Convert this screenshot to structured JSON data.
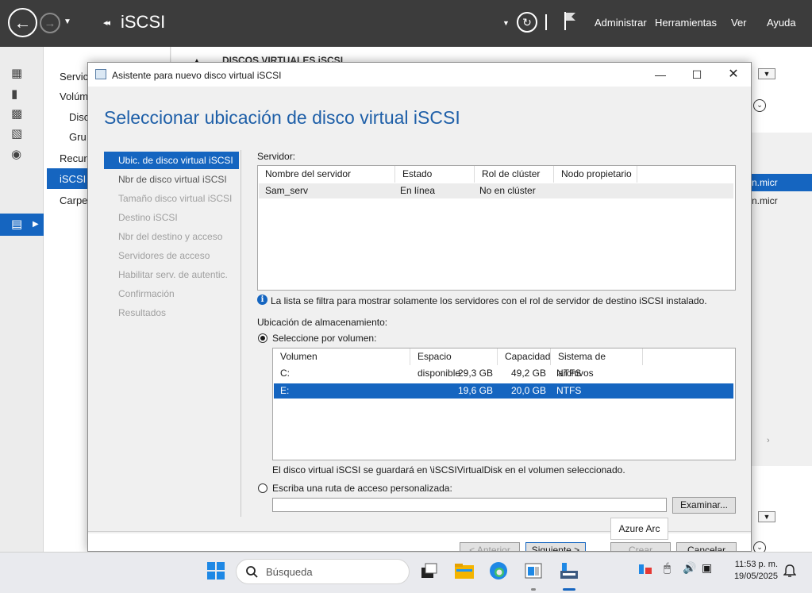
{
  "server_manager": {
    "title": "iSCSI",
    "breadcrumb_glyph": "◂◂",
    "menu": [
      "Administrar",
      "Herramientas",
      "Ver",
      "Ayuda"
    ],
    "nav_items": [
      "Servic",
      "Volúm",
      "Disc",
      "Gru",
      "Recur",
      "iSCSI",
      "Carpe"
    ],
    "main_header": "DISCOS VIRTUALES iSCSI",
    "main_side_text": [
      "n.micr",
      "n.micr"
    ]
  },
  "dialog": {
    "title": "Asistente para nuevo disco virtual iSCSI",
    "heading": "Seleccionar ubicación de disco virtual iSCSI",
    "steps": [
      {
        "label": "Ubic. de disco virtual iSCSI",
        "state": "active"
      },
      {
        "label": "Nbr de disco virtual iSCSI",
        "state": "enabled"
      },
      {
        "label": "Tamaño disco virtual iSCSI",
        "state": "disabled"
      },
      {
        "label": "Destino iSCSI",
        "state": "disabled"
      },
      {
        "label": "Nbr del destino y acceso",
        "state": "disabled"
      },
      {
        "label": "Servidores de acceso",
        "state": "disabled"
      },
      {
        "label": "Habilitar serv. de autentic.",
        "state": "disabled"
      },
      {
        "label": "Confirmación",
        "state": "disabled"
      },
      {
        "label": "Resultados",
        "state": "disabled"
      }
    ],
    "server_label": "Servidor:",
    "server_table": {
      "columns": [
        "Nombre del servidor",
        "Estado",
        "Rol de clúster",
        "Nodo propietario"
      ],
      "rows": [
        [
          "Sam_serv",
          "En línea",
          "No en clúster",
          ""
        ]
      ]
    },
    "filter_note": "La lista se filtra para mostrar solamente los servidores con el rol de servidor de destino iSCSI instalado.",
    "storage_label": "Ubicación de almacenamiento:",
    "radio_volume": "Seleccione por volumen:",
    "volume_table": {
      "columns": [
        "Volumen",
        "Espacio disponible",
        "Capacidad",
        "Sistema de archivos"
      ],
      "rows": [
        [
          "C:",
          "29,3 GB",
          "49,2 GB",
          "NTFS"
        ],
        [
          "E:",
          "19,6 GB",
          "20,0 GB",
          "NTFS"
        ]
      ],
      "selected_index": 1
    },
    "save_note": "El disco virtual iSCSI se guardará en \\iSCSIVirtualDisk en el volumen seleccionado.",
    "radio_custom": "Escriba una ruta de acceso personalizada:",
    "custom_path_value": "",
    "browse_button": "Examinar...",
    "buttons": {
      "prev": "< Anterior",
      "next": "Siguiente >",
      "create": "Crear",
      "cancel": "Cancelar"
    }
  },
  "tooltip": "Azure Arc",
  "taskbar": {
    "search_placeholder": "Búsqueda",
    "time": "11:53 p. m.",
    "date": "19/05/2025"
  },
  "colors": {
    "accent": "#1565c0",
    "heading": "#1e5fa8",
    "titlebar": "#3c3c3c"
  }
}
